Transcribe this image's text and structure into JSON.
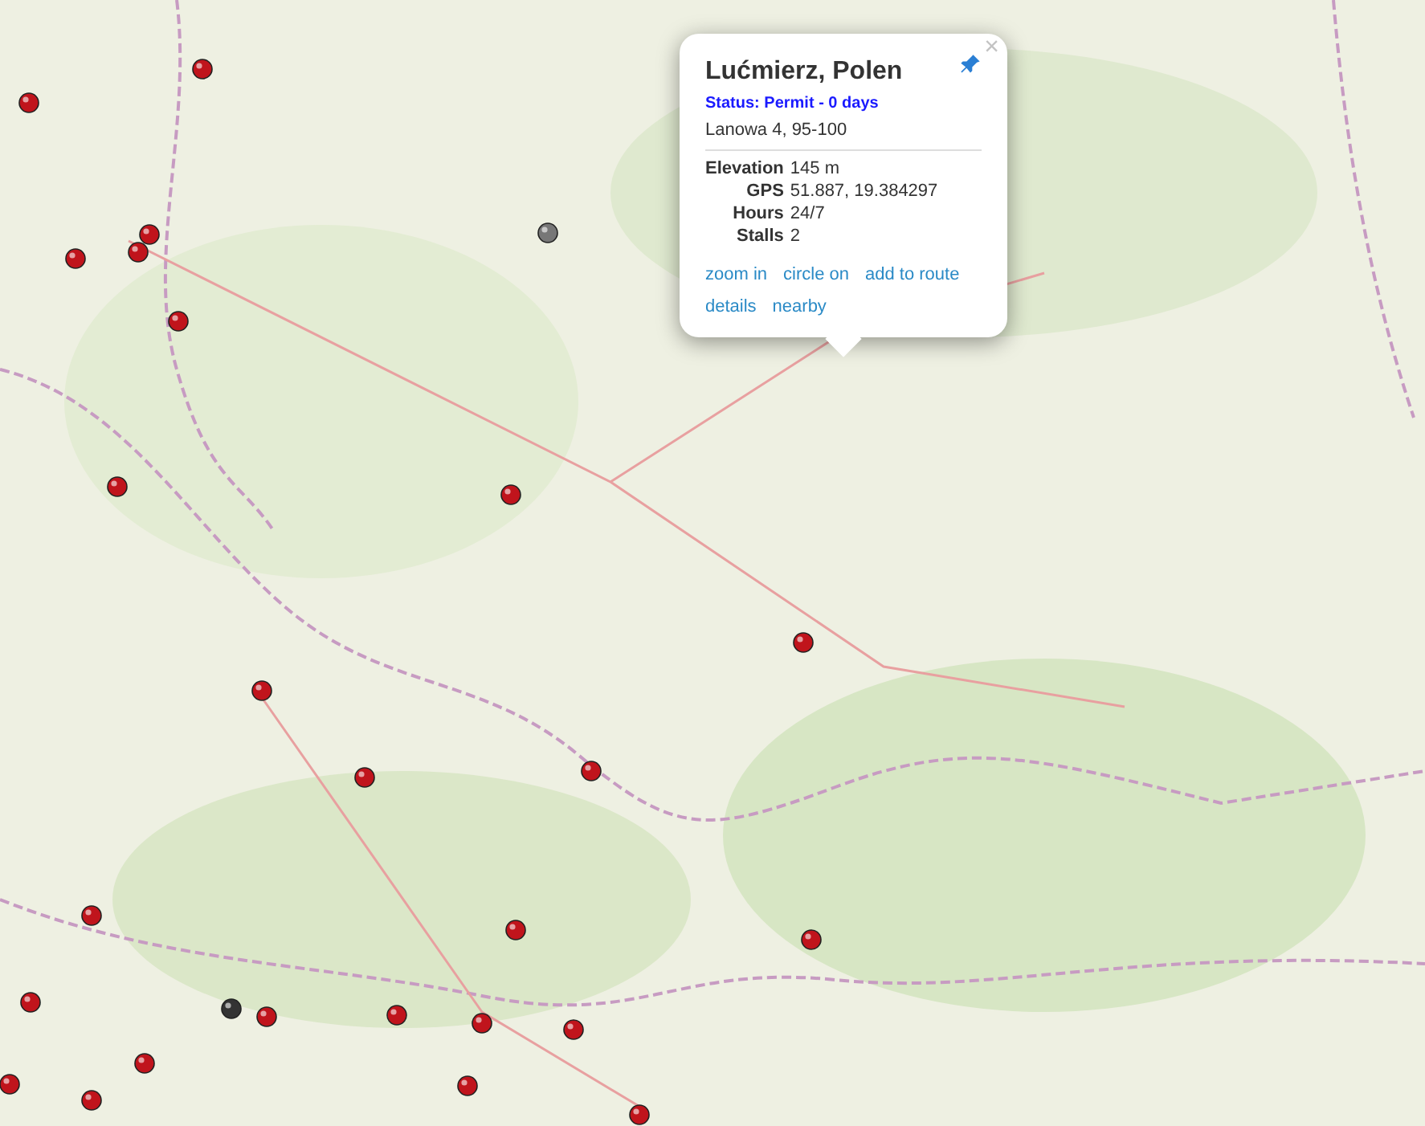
{
  "popup": {
    "title": "Lućmierz, Polen",
    "status": "Status: Permit - 0 days",
    "address": "Lanowa 4, 95-100",
    "details": [
      {
        "label": "Elevation",
        "value": "145 m"
      },
      {
        "label": "GPS",
        "value": "51.887, 19.384297"
      },
      {
        "label": "Hours",
        "value": "24/7"
      },
      {
        "label": "Stalls",
        "value": "2"
      }
    ],
    "links": [
      [
        "zoom in",
        "circle on",
        "add to route"
      ],
      [
        "details",
        "nearby"
      ]
    ],
    "close": "×"
  }
}
